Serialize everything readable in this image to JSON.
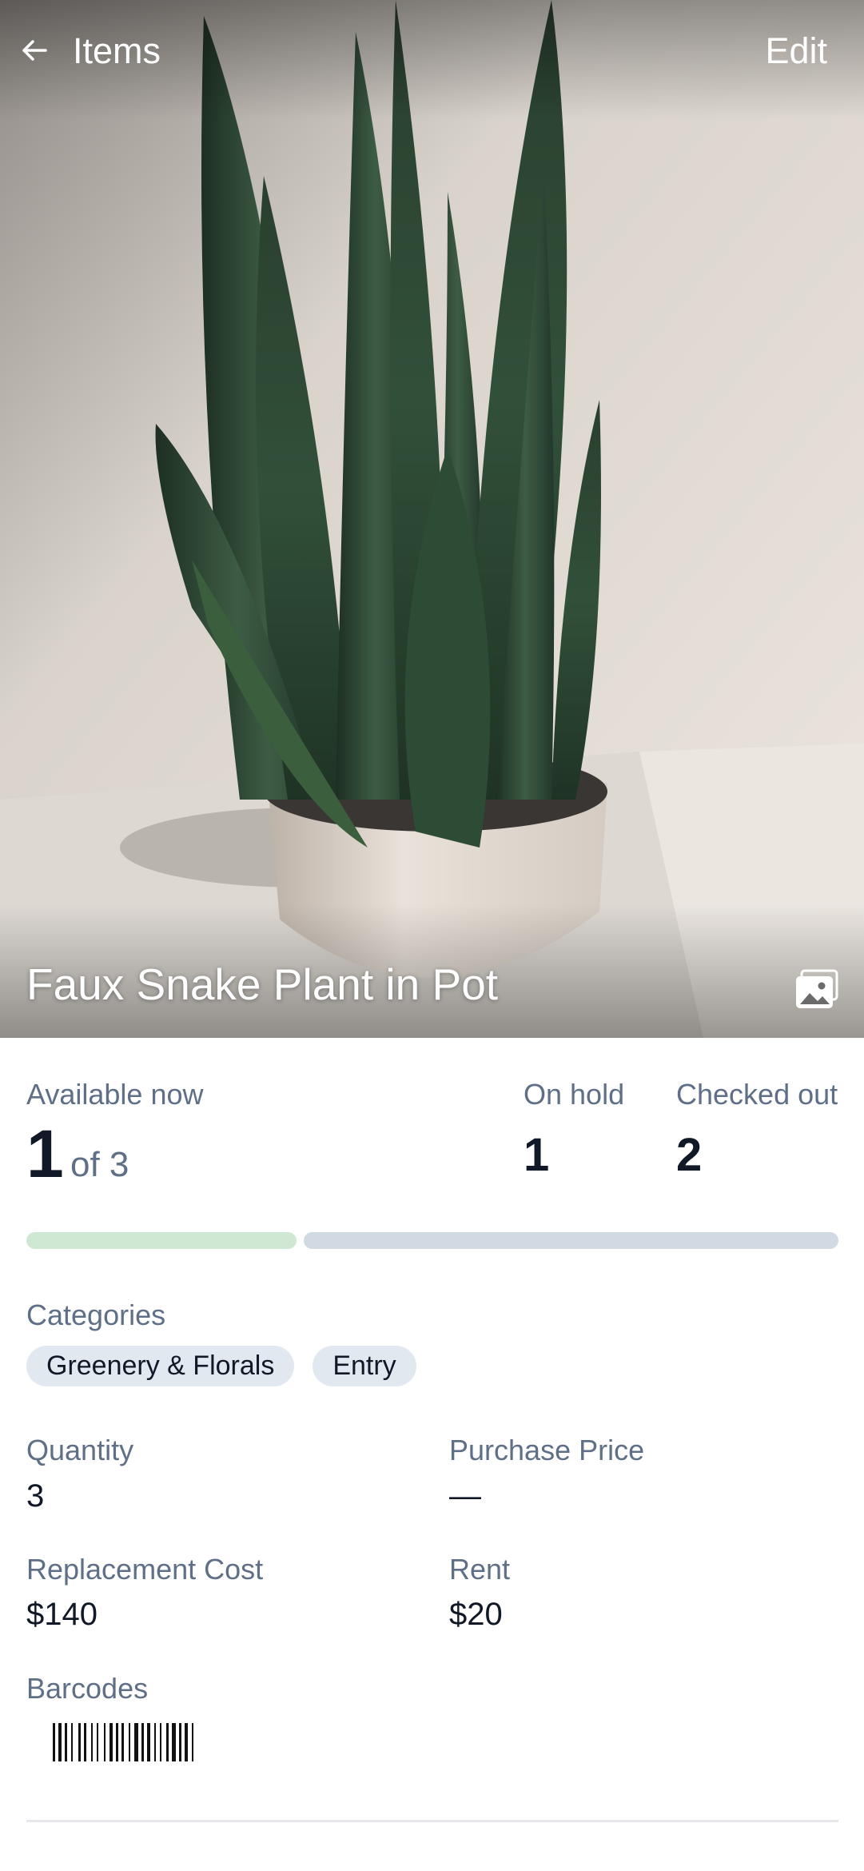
{
  "header": {
    "back_icon": "arrow-left-icon",
    "title": "Items",
    "edit_label": "Edit"
  },
  "item": {
    "name": "Faux Snake Plant in Pot",
    "gallery_icon": "image-gallery-icon"
  },
  "availability": {
    "available_label": "Available now",
    "available_count": "1",
    "total_text": "of 3",
    "on_hold_label": "On hold",
    "on_hold_count": "1",
    "checked_out_label": "Checked out",
    "checked_out_count": "2",
    "progress": {
      "available_fraction": 0.333,
      "available_color": "#cfe8d4",
      "rest_color": "#d1d9e2"
    }
  },
  "categories": {
    "label": "Categories",
    "items": [
      "Greenery & Florals",
      "Entry"
    ]
  },
  "fields": {
    "quantity_label": "Quantity",
    "quantity_value": "3",
    "purchase_price_label": "Purchase Price",
    "purchase_price_value": "—",
    "replacement_cost_label": "Replacement Cost",
    "replacement_cost_value": "$140",
    "rent_label": "Rent",
    "rent_value": "$20"
  },
  "barcodes": {
    "label": "Barcodes",
    "icon": "barcode-image"
  },
  "colors": {
    "label_gray": "#5f6f87",
    "chip_bg": "#e2e8f0",
    "text_dark": "#111827"
  }
}
